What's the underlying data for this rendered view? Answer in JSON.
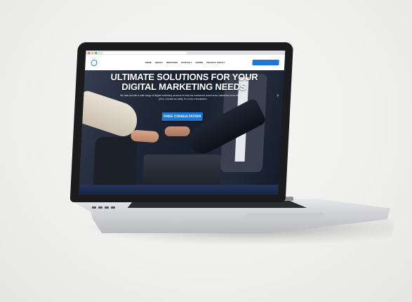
{
  "website": {
    "logo_text": "",
    "nav": {
      "items": [
        "HOME",
        "ABOUT",
        "SERVICES",
        "CONTACT",
        "TERMS",
        "PRIVACY POLICY"
      ]
    },
    "hero": {
      "title_line1": "ULTIMATE SOLUTIONS FOR YOUR",
      "title_line2": "DIGITAL MARKETING NEEDS",
      "subtitle": "We also provide a wide range of digital marketing services to help our customers reach more customers at an affordable price. Contact us today for a free consultation.",
      "cta_label": "FREE CONSULTATION",
      "next_arrow": "›"
    }
  },
  "colors": {
    "accent": "#1e78d6",
    "background": "#efefed",
    "laptop_bezel": "#1c1c1e"
  }
}
